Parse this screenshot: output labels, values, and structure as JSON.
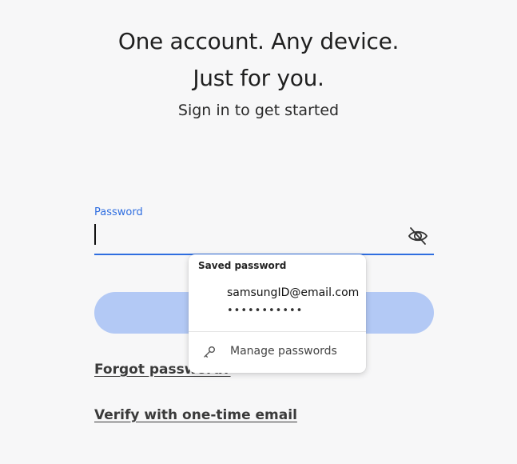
{
  "header": {
    "line1": "One account. Any device.",
    "line2": "Just for you.",
    "subtitle": "Sign in to get started"
  },
  "password_field": {
    "label": "Password",
    "value": "",
    "toggle_icon": "eye-slash-icon"
  },
  "primary_button": {
    "label": ""
  },
  "links": {
    "forgot_password": "Forgot password?",
    "verify_email": "Verify with one-time email"
  },
  "autofill_popup": {
    "title": "Saved password",
    "entry": {
      "username": "samsungID@email.com",
      "password_mask": "•••••••••••"
    },
    "manage_label": "Manage passwords",
    "manage_icon": "key-icon"
  },
  "colors": {
    "accent": "#2f6ee0",
    "button_disabled": "#b3c9f5",
    "background": "#f7f7f8"
  }
}
